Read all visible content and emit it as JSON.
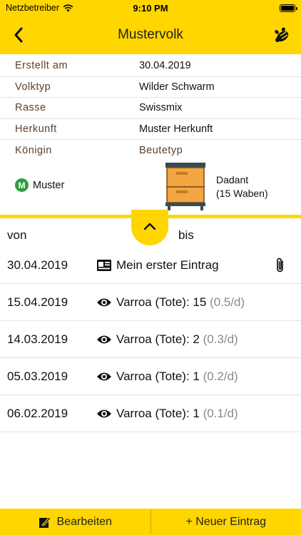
{
  "status_bar": {
    "carrier": "Netzbetreiber",
    "time": "9:10 PM",
    "battery_level": 1.0
  },
  "nav": {
    "title": "Mustervolk",
    "back_icon": "chevron-left-icon",
    "right_icon": "bee-queen-icon"
  },
  "info": {
    "rows": [
      {
        "label": "Erstellt am",
        "value": "30.04.2019"
      },
      {
        "label": "Volktyp",
        "value": "Wilder Schwarm"
      },
      {
        "label": "Rasse",
        "value": "Swissmix"
      },
      {
        "label": "Herkunft",
        "value": "Muster Herkunft"
      }
    ],
    "queen_label": "Königin",
    "hive_type_label": "Beutetyp",
    "queen": {
      "badge": "M",
      "name": "Muster",
      "badge_color": "#2e9e3c"
    },
    "hive": {
      "name": "Dadant",
      "frames": "(15 Waben)"
    }
  },
  "filter": {
    "from_label": "von",
    "to_label": "bis"
  },
  "entries": [
    {
      "date": "30.04.2019",
      "icon": "journal-icon",
      "text": "Mein erster Eintrag",
      "sub": "",
      "attachment": true
    },
    {
      "date": "15.04.2019",
      "icon": "eye-icon",
      "text": "Varroa (Tote): 15",
      "sub": "(0.5/d)",
      "attachment": false
    },
    {
      "date": "14.03.2019",
      "icon": "eye-icon",
      "text": "Varroa (Tote): 2",
      "sub": "(0.3/d)",
      "attachment": false
    },
    {
      "date": "05.03.2019",
      "icon": "eye-icon",
      "text": "Varroa (Tote): 1",
      "sub": "(0.2/d)",
      "attachment": false
    },
    {
      "date": "06.02.2019",
      "icon": "eye-icon",
      "text": "Varroa (Tote): 1",
      "sub": "(0.1/d)",
      "attachment": false
    }
  ],
  "bottom_bar": {
    "edit_label": "Bearbeiten",
    "new_label": "+ Neuer Eintrag"
  },
  "colors": {
    "accent": "#FFD600",
    "label_brown": "#5a3e2b",
    "secondary_text": "#8a8a8a"
  }
}
